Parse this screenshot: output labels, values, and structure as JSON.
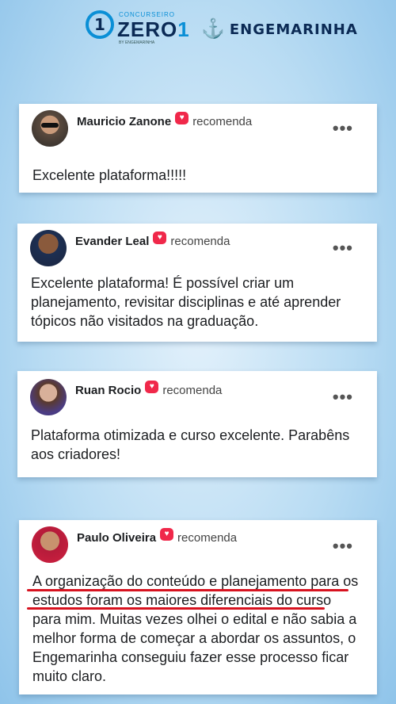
{
  "header": {
    "zero_small": "CONCURSEIRO",
    "zero_ring": "1",
    "zero_big": "ZERO",
    "zero_big_one": "1",
    "zero_tiny": "BY ENGEMARINHA",
    "anchor_glyph": "⚓",
    "eng_brand": "ENGEMARINHA"
  },
  "reviews": [
    {
      "name": "Mauricio Zanone",
      "action": "recomenda",
      "text": "Excelente plataforma!!!!!",
      "menu": "•••"
    },
    {
      "name": "Evander Leal",
      "action": "recomenda",
      "text": "Excelente plataforma! É possível criar um planejamento, revisitar disciplinas e até aprender tópicos não visitados na graduação.",
      "menu": "•••"
    },
    {
      "name": "Ruan Rocio",
      "action": "recomenda",
      "text": "Plataforma otimizada e curso excelente. Parabêns aos criadores!",
      "menu": "•••"
    },
    {
      "name": "Paulo Oliveira",
      "action": "recomenda",
      "text": "A organização do conteúdo e planejamento para os estudos foram os maiores diferenciais do curso para mim. Muitas vezes olhei o edital e não sabia a melhor forma de começar a abordar os assuntos, o Engemarinha conseguiu fazer esse processo ficar muito claro.",
      "menu": "•••"
    }
  ],
  "colors": {
    "accent_blue": "#0a8fd6",
    "brand_navy": "#0b2a55",
    "recommend_red": "#f0284a",
    "highlight_underline": "#d7121f"
  },
  "icons": {
    "recommend": "heart-chat-icon",
    "menu": "more-dots-icon",
    "anchor": "anchor-icon"
  }
}
